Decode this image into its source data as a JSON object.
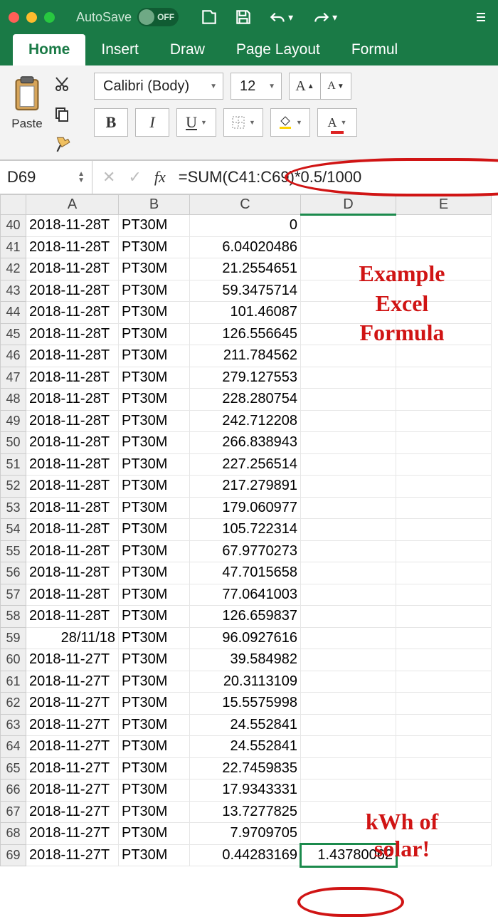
{
  "autosave": {
    "label": "AutoSave",
    "state": "OFF"
  },
  "tabs": [
    "Home",
    "Insert",
    "Draw",
    "Page Layout",
    "Formul"
  ],
  "activeTab": "Home",
  "paste_label": "Paste",
  "font": {
    "name": "Calibri (Body)",
    "size": "12"
  },
  "namebox": "D69",
  "formula": "=SUM(C41:C69)*0.5/1000",
  "columns": [
    "A",
    "B",
    "C",
    "D",
    "E"
  ],
  "rows": [
    {
      "n": 40,
      "a": "2018-11-28T",
      "b": "PT30M",
      "c": "0",
      "d": ""
    },
    {
      "n": 41,
      "a": "2018-11-28T",
      "b": "PT30M",
      "c": "6.04020486",
      "d": ""
    },
    {
      "n": 42,
      "a": "2018-11-28T",
      "b": "PT30M",
      "c": "21.2554651",
      "d": ""
    },
    {
      "n": 43,
      "a": "2018-11-28T",
      "b": "PT30M",
      "c": "59.3475714",
      "d": ""
    },
    {
      "n": 44,
      "a": "2018-11-28T",
      "b": "PT30M",
      "c": "101.46087",
      "d": ""
    },
    {
      "n": 45,
      "a": "2018-11-28T",
      "b": "PT30M",
      "c": "126.556645",
      "d": ""
    },
    {
      "n": 46,
      "a": "2018-11-28T",
      "b": "PT30M",
      "c": "211.784562",
      "d": ""
    },
    {
      "n": 47,
      "a": "2018-11-28T",
      "b": "PT30M",
      "c": "279.127553",
      "d": ""
    },
    {
      "n": 48,
      "a": "2018-11-28T",
      "b": "PT30M",
      "c": "228.280754",
      "d": ""
    },
    {
      "n": 49,
      "a": "2018-11-28T",
      "b": "PT30M",
      "c": "242.712208",
      "d": ""
    },
    {
      "n": 50,
      "a": "2018-11-28T",
      "b": "PT30M",
      "c": "266.838943",
      "d": ""
    },
    {
      "n": 51,
      "a": "2018-11-28T",
      "b": "PT30M",
      "c": "227.256514",
      "d": ""
    },
    {
      "n": 52,
      "a": "2018-11-28T",
      "b": "PT30M",
      "c": "217.279891",
      "d": ""
    },
    {
      "n": 53,
      "a": "2018-11-28T",
      "b": "PT30M",
      "c": "179.060977",
      "d": ""
    },
    {
      "n": 54,
      "a": "2018-11-28T",
      "b": "PT30M",
      "c": "105.722314",
      "d": ""
    },
    {
      "n": 55,
      "a": "2018-11-28T",
      "b": "PT30M",
      "c": "67.9770273",
      "d": ""
    },
    {
      "n": 56,
      "a": "2018-11-28T",
      "b": "PT30M",
      "c": "47.7015658",
      "d": ""
    },
    {
      "n": 57,
      "a": "2018-11-28T",
      "b": "PT30M",
      "c": "77.0641003",
      "d": ""
    },
    {
      "n": 58,
      "a": "2018-11-28T",
      "b": "PT30M",
      "c": "126.659837",
      "d": ""
    },
    {
      "n": 59,
      "a": "28/11/18",
      "b": "PT30M",
      "c": "96.0927616",
      "d": ""
    },
    {
      "n": 60,
      "a": "2018-11-27T",
      "b": "PT30M",
      "c": "39.584982",
      "d": ""
    },
    {
      "n": 61,
      "a": "2018-11-27T",
      "b": "PT30M",
      "c": "20.3113109",
      "d": ""
    },
    {
      "n": 62,
      "a": "2018-11-27T",
      "b": "PT30M",
      "c": "15.5575998",
      "d": ""
    },
    {
      "n": 63,
      "a": "2018-11-27T",
      "b": "PT30M",
      "c": "24.552841",
      "d": ""
    },
    {
      "n": 64,
      "a": "2018-11-27T",
      "b": "PT30M",
      "c": "24.552841",
      "d": ""
    },
    {
      "n": 65,
      "a": "2018-11-27T",
      "b": "PT30M",
      "c": "22.7459835",
      "d": ""
    },
    {
      "n": 66,
      "a": "2018-11-27T",
      "b": "PT30M",
      "c": "17.9343331",
      "d": ""
    },
    {
      "n": 67,
      "a": "2018-11-27T",
      "b": "PT30M",
      "c": "13.7277825",
      "d": ""
    },
    {
      "n": 68,
      "a": "2018-11-27T",
      "b": "PT30M",
      "c": "7.9709705",
      "d": ""
    },
    {
      "n": 69,
      "a": "2018-11-27T",
      "b": "PT30M",
      "c": "0.44283169",
      "d": "1.43780062"
    }
  ],
  "annotation1": "Example\nExcel\nFormula",
  "annotation2": "kWh of\nsolar!"
}
